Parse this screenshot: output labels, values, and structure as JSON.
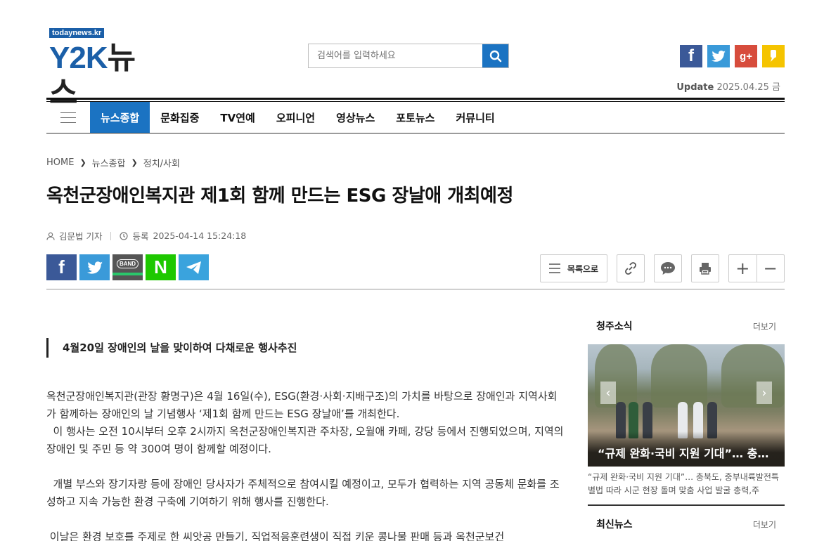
{
  "header": {
    "logo_sub": "todaynews.kr",
    "logo_main_a": "Y2K",
    "logo_main_b": "뉴스",
    "search_placeholder": "검색어를 입력하세요",
    "update_label": "Update",
    "update_date": "2025.04.25 금",
    "social_icons": [
      "facebook-icon",
      "twitter-icon",
      "google-plus-icon",
      "kakao-icon"
    ]
  },
  "nav": {
    "items": [
      "뉴스종합",
      "문화집중",
      "TV연예",
      "오피니언",
      "영상뉴스",
      "포토뉴스",
      "커뮤니티"
    ],
    "active_index": 0
  },
  "breadcrumb": [
    "HOME",
    "뉴스종합",
    "정치/사회"
  ],
  "article": {
    "title": "옥천군장애인복지관 제1회 함께 만드는 ESG 장날애 개최예정",
    "author": "김문법 기자",
    "date_label": "등록",
    "date": "2025-04-14 15:24:18",
    "subhead": "4월20일 장애인의 날을 맞이하여 다채로운 행사추진",
    "paragraphs": [
      "옥천군장애인복지관(관장 황명구)은 4월 16일(수), ESG(환경·사회·지배구조)의 가치를 바탕으로 장애인과 지역사회가 함께하는 장애인의 날 기념행사 ‘제1회 함께 만드는 ESG 장날애’를 개최한다.",
      "  이 행사는 오전 10시부터 오후 2시까지 옥천군장애인복지관 주차장, 오월애 카페, 강당 등에서 진행되었으며, 지역의 장애인 및 주민 등 약 300여 명이 함께할 예정이다.",
      "",
      "  개별 부스와 장기자랑 등에 장애인 당사자가 주체적으로 참여시킬 예정이고, 모두가 협력하는 지역 공동체 문화를 조성하고 지속 가능한 환경 구축에 기여하기 위해 행사를 진행한다.",
      "",
      " 이날은 환경 보호를 주제로 한 씨앗공 만들기, 직업적응훈련생이 직접 키운 콩나물 판매 등과 옥천군보건"
    ]
  },
  "share": {
    "band_label": "BAND",
    "naver_label": "N"
  },
  "tools": {
    "list_label": "목록으로",
    "zoom_in": "+",
    "zoom_out": "−"
  },
  "sidebar": {
    "section1_title": "청주소식",
    "section1_more": "더보기",
    "photo_caption": "“규제 완화·국비 지원 기대”… 충북도, 중부내륙법",
    "photo_desc": "“규제 완화·국비 지원 기대”… 충북도, 중부내륙발전특별법 따라 시군 현장 돌며 맞춤 사업 발굴 총력,주",
    "section2_title": "최신뉴스",
    "section2_more": "더보기"
  }
}
